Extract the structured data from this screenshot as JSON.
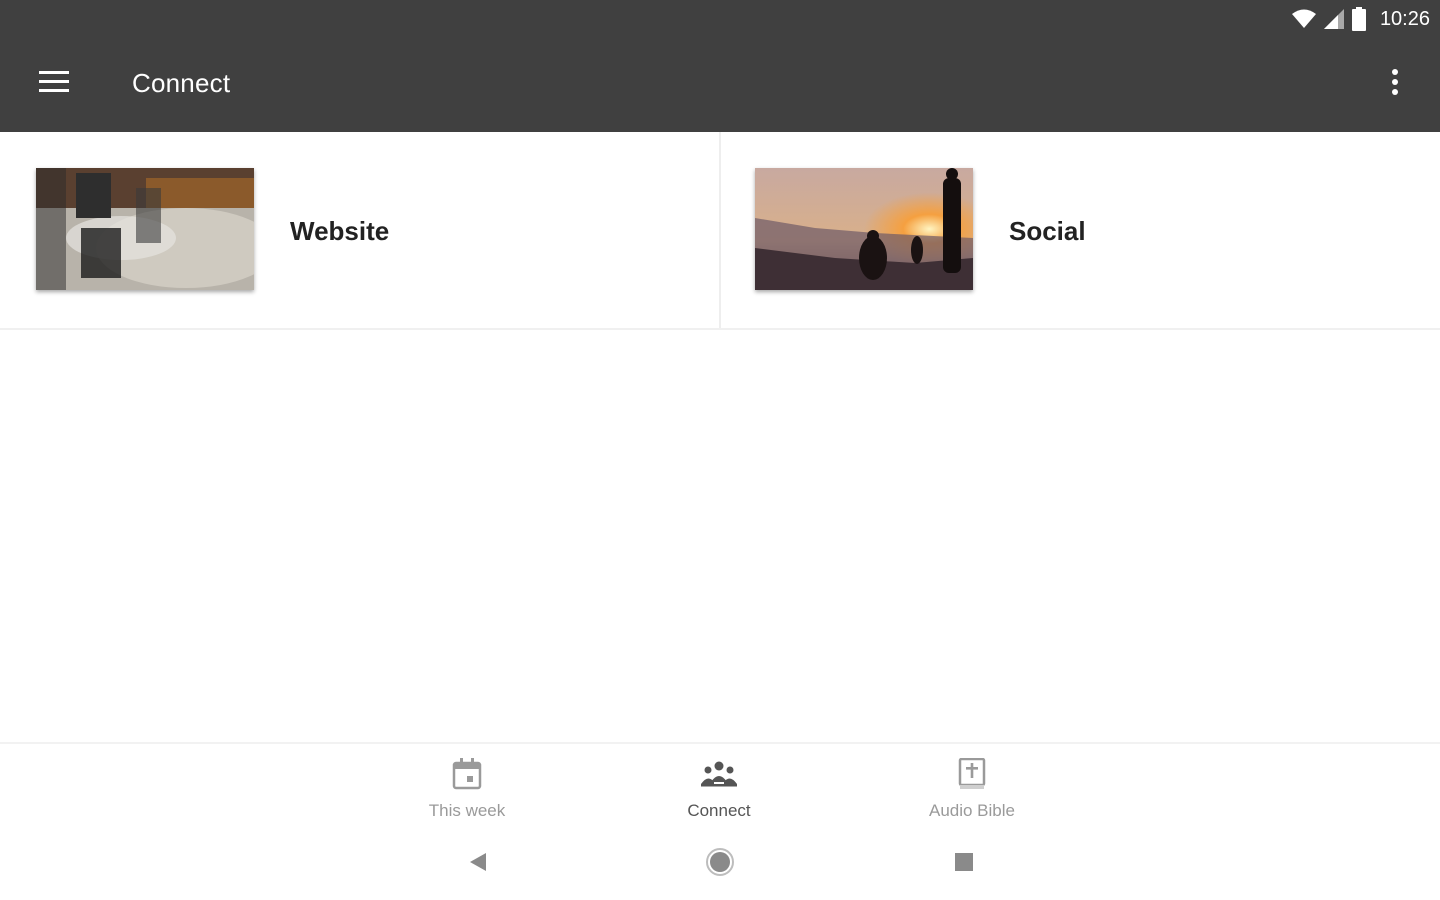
{
  "status_bar": {
    "time": "10:26",
    "icons": [
      "wifi-icon",
      "cellular-signal-icon",
      "battery-icon"
    ]
  },
  "app_bar": {
    "title": "Connect",
    "menu_icon": "hamburger-menu-icon",
    "overflow_icon": "more-vert-icon",
    "background": "#404040"
  },
  "cards": [
    {
      "label": "Website",
      "image": "living-room-photo"
    },
    {
      "label": "Social",
      "image": "sunset-people-photo"
    }
  ],
  "bottom_nav": {
    "items": [
      {
        "label": "This week",
        "icon": "calendar-icon",
        "active": false
      },
      {
        "label": "Connect",
        "icon": "group-icon",
        "active": true
      },
      {
        "label": "Audio Bible",
        "icon": "bible-icon",
        "active": false
      }
    ]
  },
  "system_nav": {
    "buttons": [
      "back-icon",
      "home-icon",
      "recents-icon"
    ]
  },
  "colors": {
    "appbar": "#404040",
    "text_primary": "#222222",
    "nav_inactive": "#9a9a9a",
    "nav_active": "#555555"
  }
}
